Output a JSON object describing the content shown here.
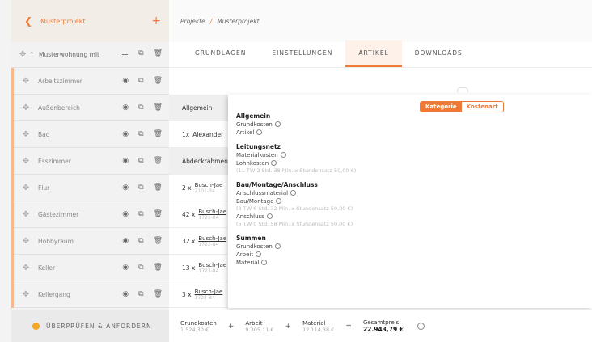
{
  "sidebar": {
    "back_icon": "chevron-left-icon",
    "title": "Musterprojekt",
    "add_icon": "plus-icon",
    "top": {
      "label": "Musterwohnung mit"
    },
    "rooms": [
      {
        "label": "Arbeitszimmer"
      },
      {
        "label": "Außenbereich"
      },
      {
        "label": "Bad"
      },
      {
        "label": "Esszimmer"
      },
      {
        "label": "Flur"
      },
      {
        "label": "Gästezimmer"
      },
      {
        "label": "Hobbyraum"
      },
      {
        "label": "Keller"
      },
      {
        "label": "Kellergang"
      }
    ],
    "footer_label": "ÜBERPRÜFEN & ANFORDERN"
  },
  "breadcrumb": {
    "root": "Projekte",
    "sep": "/",
    "current": "Musterprojekt"
  },
  "tabs": [
    {
      "label": "GRUNDLAGEN"
    },
    {
      "label": "EINSTELLUNGEN"
    },
    {
      "label": "ARTIKEL"
    },
    {
      "label": "DOWNLOADS"
    }
  ],
  "rows": [
    {
      "qty": "",
      "name": "Allgemein",
      "sub": ""
    },
    {
      "qty": "1x",
      "name": "Alexander",
      "sub": ""
    },
    {
      "qty": "",
      "name": "Abdeckrahmen",
      "sub": ""
    },
    {
      "qty": "2 x",
      "name": "Busch-Jae",
      "sub": "2101-34"
    },
    {
      "qty": "42 x",
      "name": "Busch-Jae",
      "sub": "1721-84"
    },
    {
      "qty": "32 x",
      "name": "Busch-Jae",
      "sub": "1722-84"
    },
    {
      "qty": "13 x",
      "name": "Busch-Jae",
      "sub": "1723-84"
    },
    {
      "qty": "3 x",
      "name": "Busch-Jae",
      "sub": "1724-84"
    }
  ],
  "popup": {
    "toggle_on": "Kategorie",
    "toggle_off": "Kostenart",
    "s1": {
      "title": "Allgemein",
      "l1": "Grundkosten",
      "l2": "Artikel"
    },
    "s2": {
      "title": "Leitungsnetz",
      "l1": "Materialkosten",
      "l2": "Lohnkosten",
      "h2": "(11 TW 2 Std. 38 Min. x Stundensatz 50,00 €)"
    },
    "s3": {
      "title": "Bau/Montage/Anschluss",
      "l1": "Anschlussmaterial",
      "l2": "Bau/Montage",
      "h2": "(8 TW 6 Std. 32 Min. x Stundensatz 50,00 €)",
      "l3": "Anschluss",
      "h3": "(5 TW 0 Std. 58 Min. x Stundensatz 50,00 €)"
    },
    "s4": {
      "title": "Summen",
      "l1": "Grundkosten",
      "l2": "Arbeit",
      "l3": "Material"
    }
  },
  "footer": {
    "grund_k": "Grundkosten",
    "grund_v": "1.524,30 €",
    "arbeit_k": "Arbeit",
    "arbeit_v": "9.305,11 €",
    "material_k": "Material",
    "material_v": "12.114,38 €",
    "total_k": "Gesamtpreis",
    "total_v": "22.943,79 €",
    "plus": "+",
    "eq": "="
  }
}
